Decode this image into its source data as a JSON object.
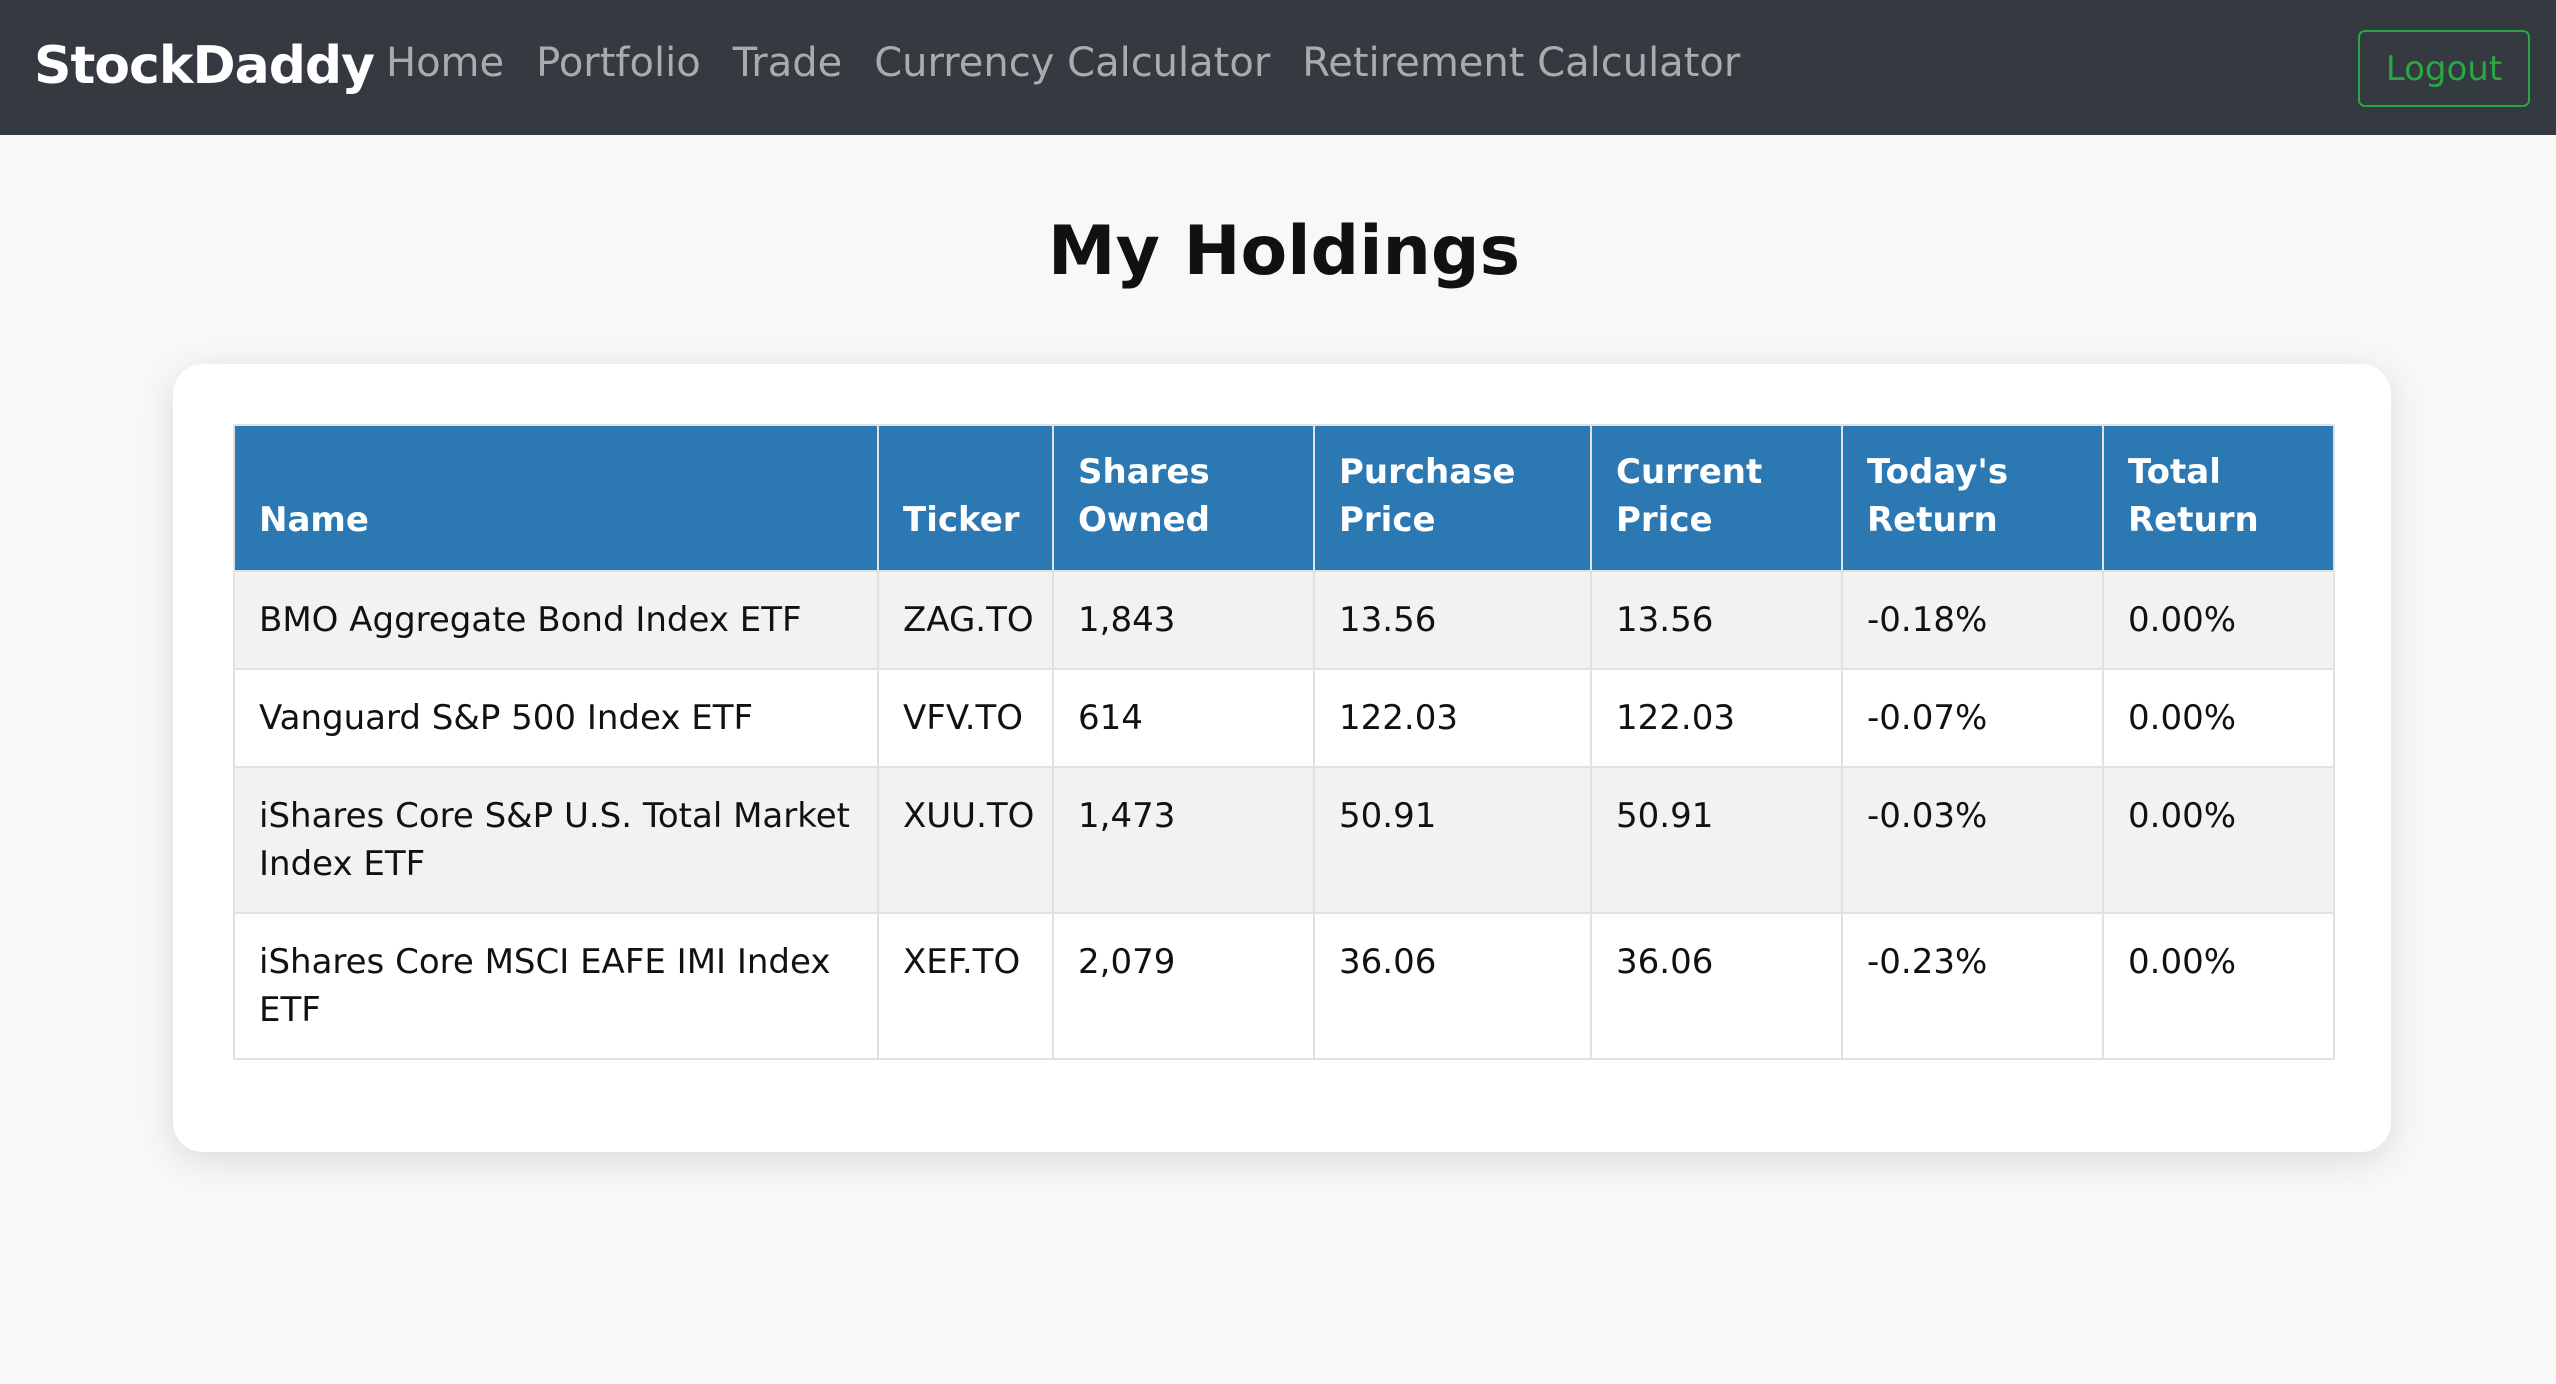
{
  "navbar": {
    "brand": "StockDaddy",
    "links": [
      "Home",
      "Portfolio",
      "Trade",
      "Currency Calculator",
      "Retirement Calculator"
    ],
    "logout_label": "Logout"
  },
  "page_title": "My Holdings",
  "table": {
    "headers": [
      "Name",
      "Ticker",
      "Shares Owned",
      "Purchase Price",
      "Current Price",
      "Today's Return",
      "Total Return"
    ],
    "rows": [
      [
        "BMO Aggregate Bond Index ETF",
        "ZAG.TO",
        "1,843",
        "13.56",
        "13.56",
        "-0.18%",
        "0.00%"
      ],
      [
        "Vanguard S&P 500 Index ETF",
        "VFV.TO",
        "614",
        "122.03",
        "122.03",
        "-0.07%",
        "0.00%"
      ],
      [
        "iShares Core S&P U.S. Total Market Index ETF",
        "XUU.TO",
        "1,473",
        "50.91",
        "50.91",
        "-0.03%",
        "0.00%"
      ],
      [
        "iShares Core MSCI EAFE IMI Index ETF",
        "XEF.TO",
        "2,079",
        "36.06",
        "36.06",
        "-0.23%",
        "0.00%"
      ]
    ]
  },
  "colors": {
    "navbar_bg": "#343a40",
    "table_header_bg": "#2c78b3",
    "logout_accent": "#28a745"
  }
}
